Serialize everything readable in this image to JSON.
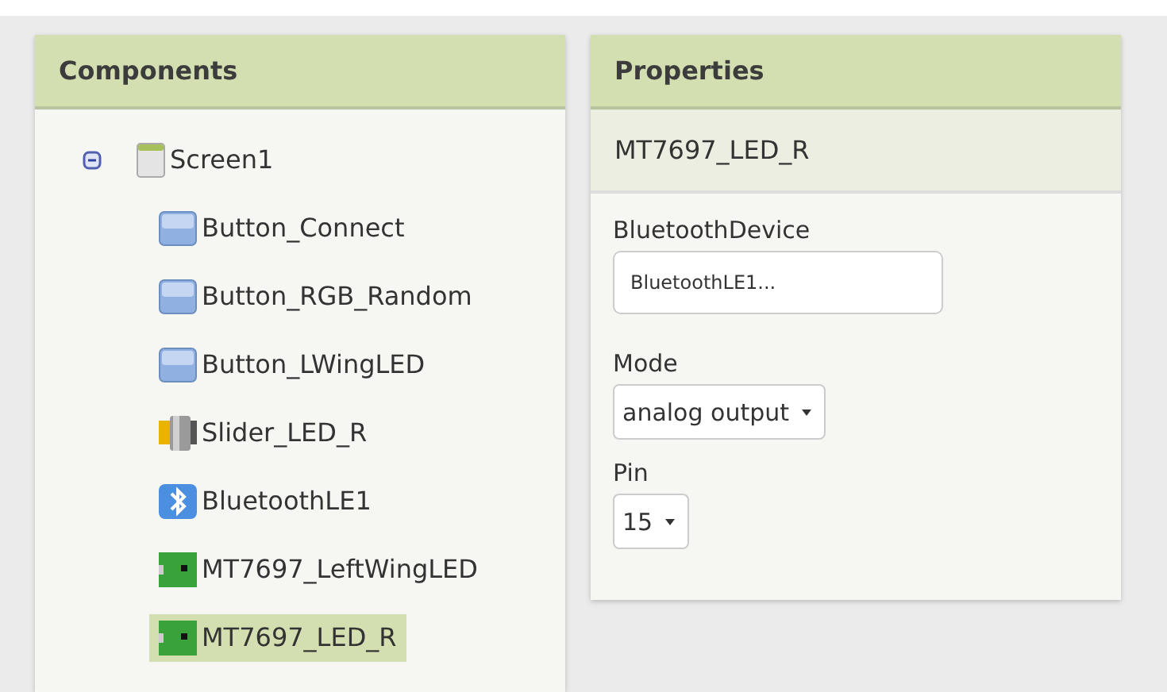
{
  "components_panel": {
    "title": "Components",
    "tree": [
      {
        "label": "Screen1",
        "kind": "screen",
        "expanded": true,
        "selected": false,
        "children": [
          {
            "label": "Button_Connect",
            "kind": "button",
            "selected": false
          },
          {
            "label": "Button_RGB_Random",
            "kind": "button",
            "selected": false
          },
          {
            "label": "Button_LWingLED",
            "kind": "button",
            "selected": false
          },
          {
            "label": "Slider_LED_R",
            "kind": "slider",
            "selected": false
          },
          {
            "label": "BluetoothLE1",
            "kind": "bluetooth",
            "selected": false
          },
          {
            "label": "MT7697_LeftWingLED",
            "kind": "board",
            "selected": false
          },
          {
            "label": "MT7697_LED_R",
            "kind": "board",
            "selected": true
          }
        ]
      }
    ]
  },
  "properties_panel": {
    "title": "Properties",
    "component_name": "MT7697_LED_R",
    "properties": [
      {
        "label": "BluetoothDevice",
        "kind": "textbox",
        "value": "BluetoothLE1..."
      },
      {
        "label": "Mode",
        "kind": "dropdown",
        "value": "analog output"
      },
      {
        "label": "Pin",
        "kind": "dropdown",
        "value": "15"
      }
    ]
  }
}
